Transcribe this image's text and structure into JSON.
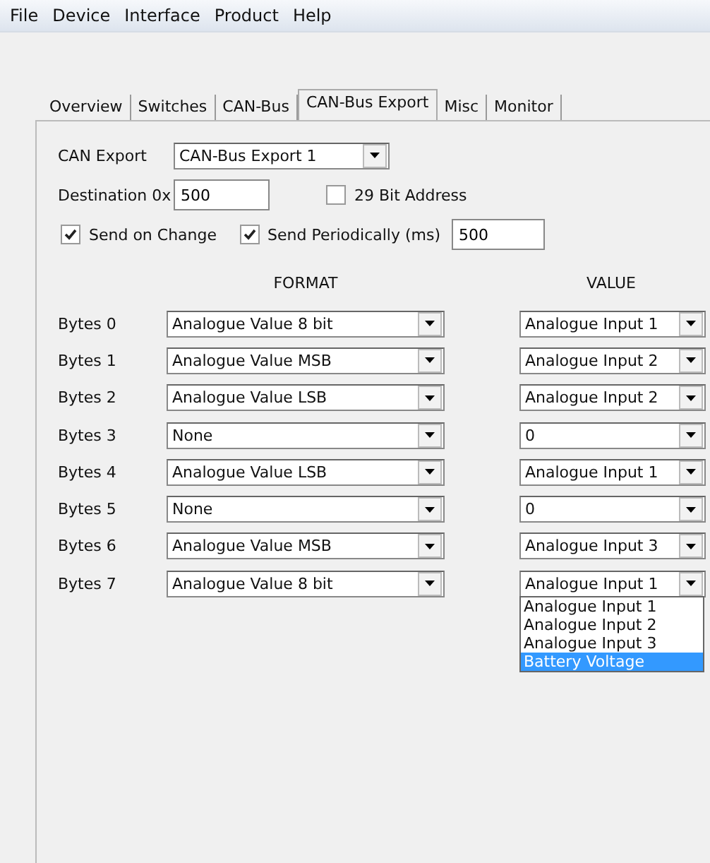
{
  "menu": [
    "File",
    "Device",
    "Interface",
    "Product",
    "Help"
  ],
  "tabs": [
    {
      "label": "Overview",
      "selected": false
    },
    {
      "label": "Switches",
      "selected": false
    },
    {
      "label": "CAN-Bus",
      "selected": false
    },
    {
      "label": "CAN-Bus Export",
      "selected": true
    },
    {
      "label": "Misc",
      "selected": false
    },
    {
      "label": "Monitor",
      "selected": false
    }
  ],
  "can_export": {
    "label": "CAN Export",
    "value": "CAN-Bus Export 1"
  },
  "destination": {
    "label": "Destination  0x",
    "value": "500"
  },
  "address_29bit": {
    "label": "29 Bit Address",
    "checked": false
  },
  "send_on_change": {
    "label": "Send on Change",
    "checked": true
  },
  "send_periodically": {
    "label": "Send Periodically (ms)",
    "checked": true,
    "value": "500"
  },
  "columns": {
    "format": "FORMAT",
    "value": "VALUE"
  },
  "bytes": [
    {
      "label": "Bytes 0",
      "format": "Analogue  Value 8 bit",
      "value": "Analogue Input 1",
      "expanded": false
    },
    {
      "label": "Bytes 1",
      "format": "Analogue  Value MSB",
      "value": "Analogue Input 2",
      "expanded": false
    },
    {
      "label": "Bytes 2",
      "format": "Analogue  Value LSB",
      "value": "Analogue Input 2",
      "expanded": false
    },
    {
      "label": "Bytes 3",
      "format": "None",
      "value": "0",
      "expanded": false
    },
    {
      "label": "Bytes 4",
      "format": "Analogue  Value LSB",
      "value": "Analogue Input 1",
      "expanded": false
    },
    {
      "label": "Bytes 5",
      "format": "None",
      "value": "0",
      "expanded": false
    },
    {
      "label": "Bytes 6",
      "format": "Analogue  Value MSB",
      "value": "Analogue Input 3",
      "expanded": false
    },
    {
      "label": "Bytes 7",
      "format": "Analogue  Value 8 bit",
      "value": "Analogue Input 1",
      "expanded": true
    }
  ],
  "value_options": [
    {
      "label": "Analogue Input 1",
      "selected": false
    },
    {
      "label": "Analogue Input 2",
      "selected": false
    },
    {
      "label": "Analogue Input 3",
      "selected": false
    },
    {
      "label": "Battery Voltage",
      "selected": true
    }
  ]
}
